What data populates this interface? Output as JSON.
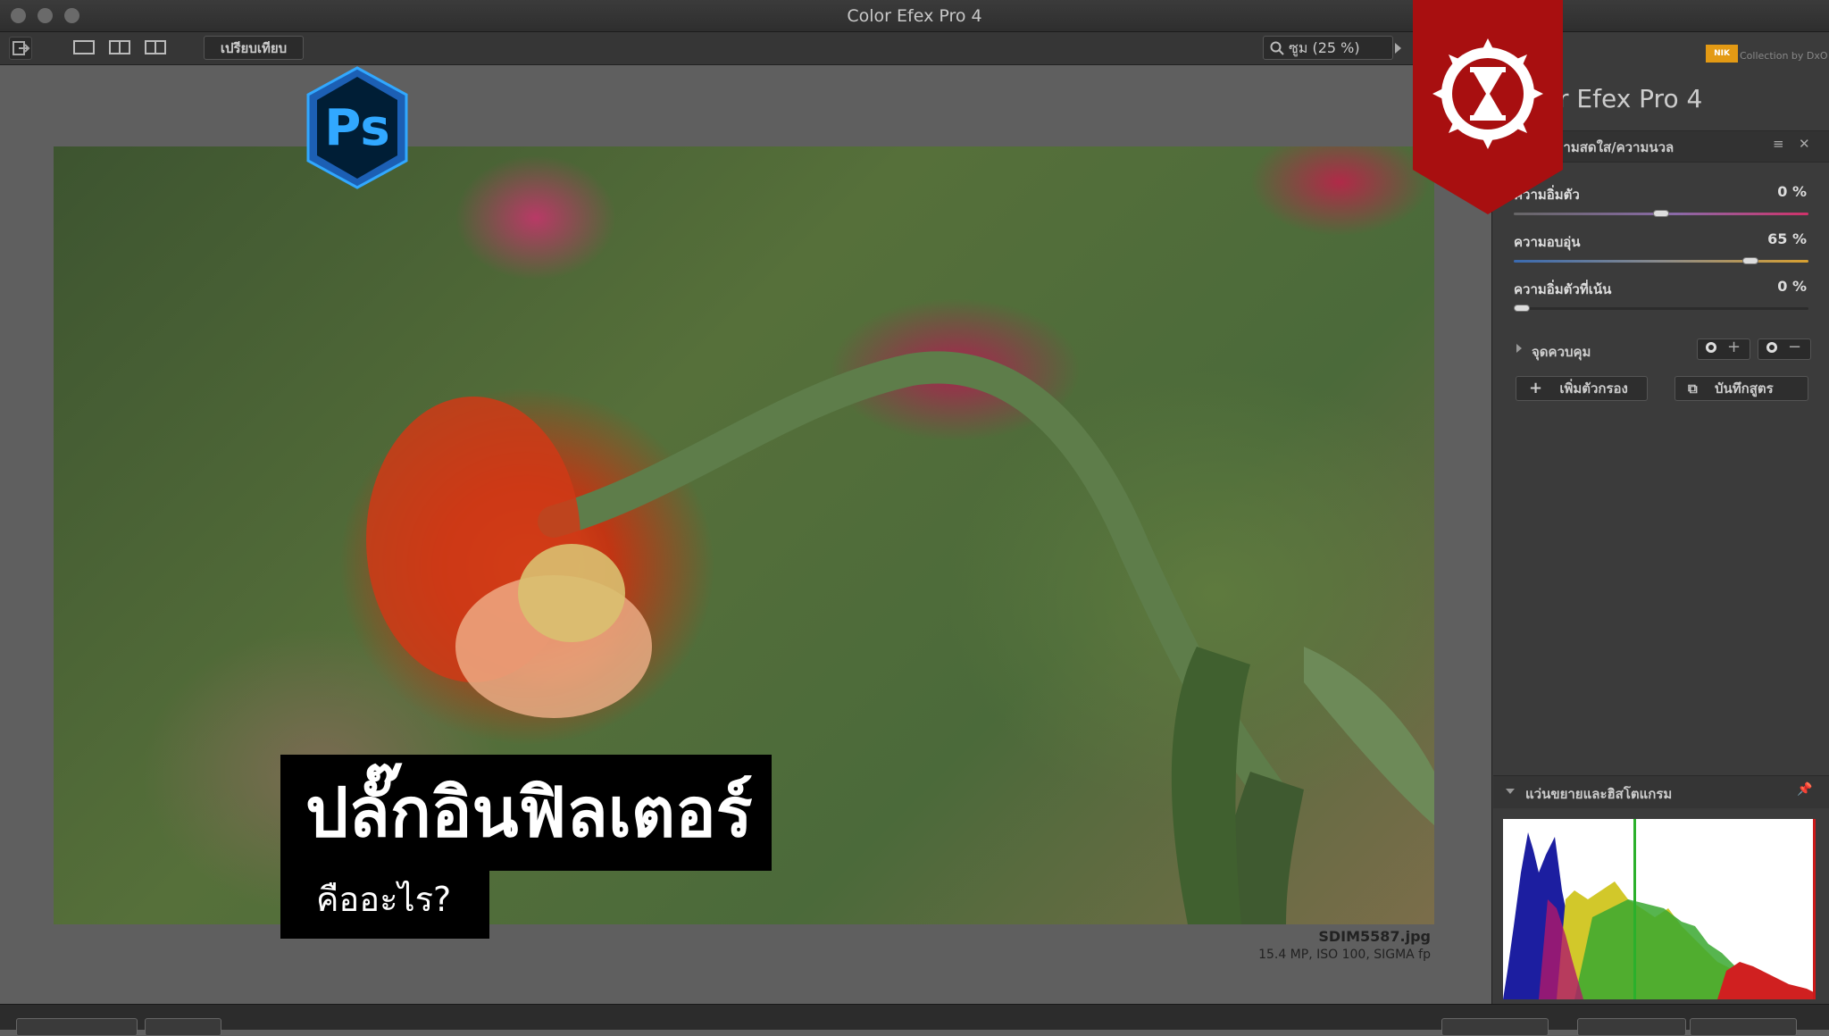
{
  "window": {
    "title": "Color Efex Pro 4"
  },
  "toolbar": {
    "compare_label": "เปรียบเทียบ",
    "zoom_label": "ซูม (25 %)"
  },
  "overlay": {
    "headline": "ปลั๊กอินฟิลเตอร์",
    "subline": "คืออะไร?",
    "ps_logo_text": "Ps"
  },
  "image_info": {
    "file_name": "SDIM5587.jpg",
    "meta": "15.4 MP, ISO 100, SIGMA fp"
  },
  "panel": {
    "brand_logo": "NIK",
    "brand_by": "Collection by DxO",
    "app_name_visible": "r Efex Pro 4",
    "filter_name_visible": "วามสดใส/ความนวล",
    "sliders": [
      {
        "label": "ความอิ่มตัว",
        "value": "0 %",
        "level": 0.5
      },
      {
        "label": "ความอบอุ่น",
        "value": "65 %",
        "level": 0.82
      },
      {
        "label": "ความอิ่มตัวที่เน้น",
        "value": "0 %",
        "level": 0.0
      }
    ],
    "control_points_label": "จุดควบคุม",
    "add_filter_label": "เพิ่มตัวกรอง",
    "save_recipe_label": "บันทึกสูตร",
    "loupe_histogram_label": "แว่นขยายและฮิสโตแกรม"
  },
  "colors": {
    "badge_red": "#a80f10",
    "ps_blue": "#31a8ff",
    "ps_dark": "#001e36",
    "nik_orange": "#e39a14"
  }
}
